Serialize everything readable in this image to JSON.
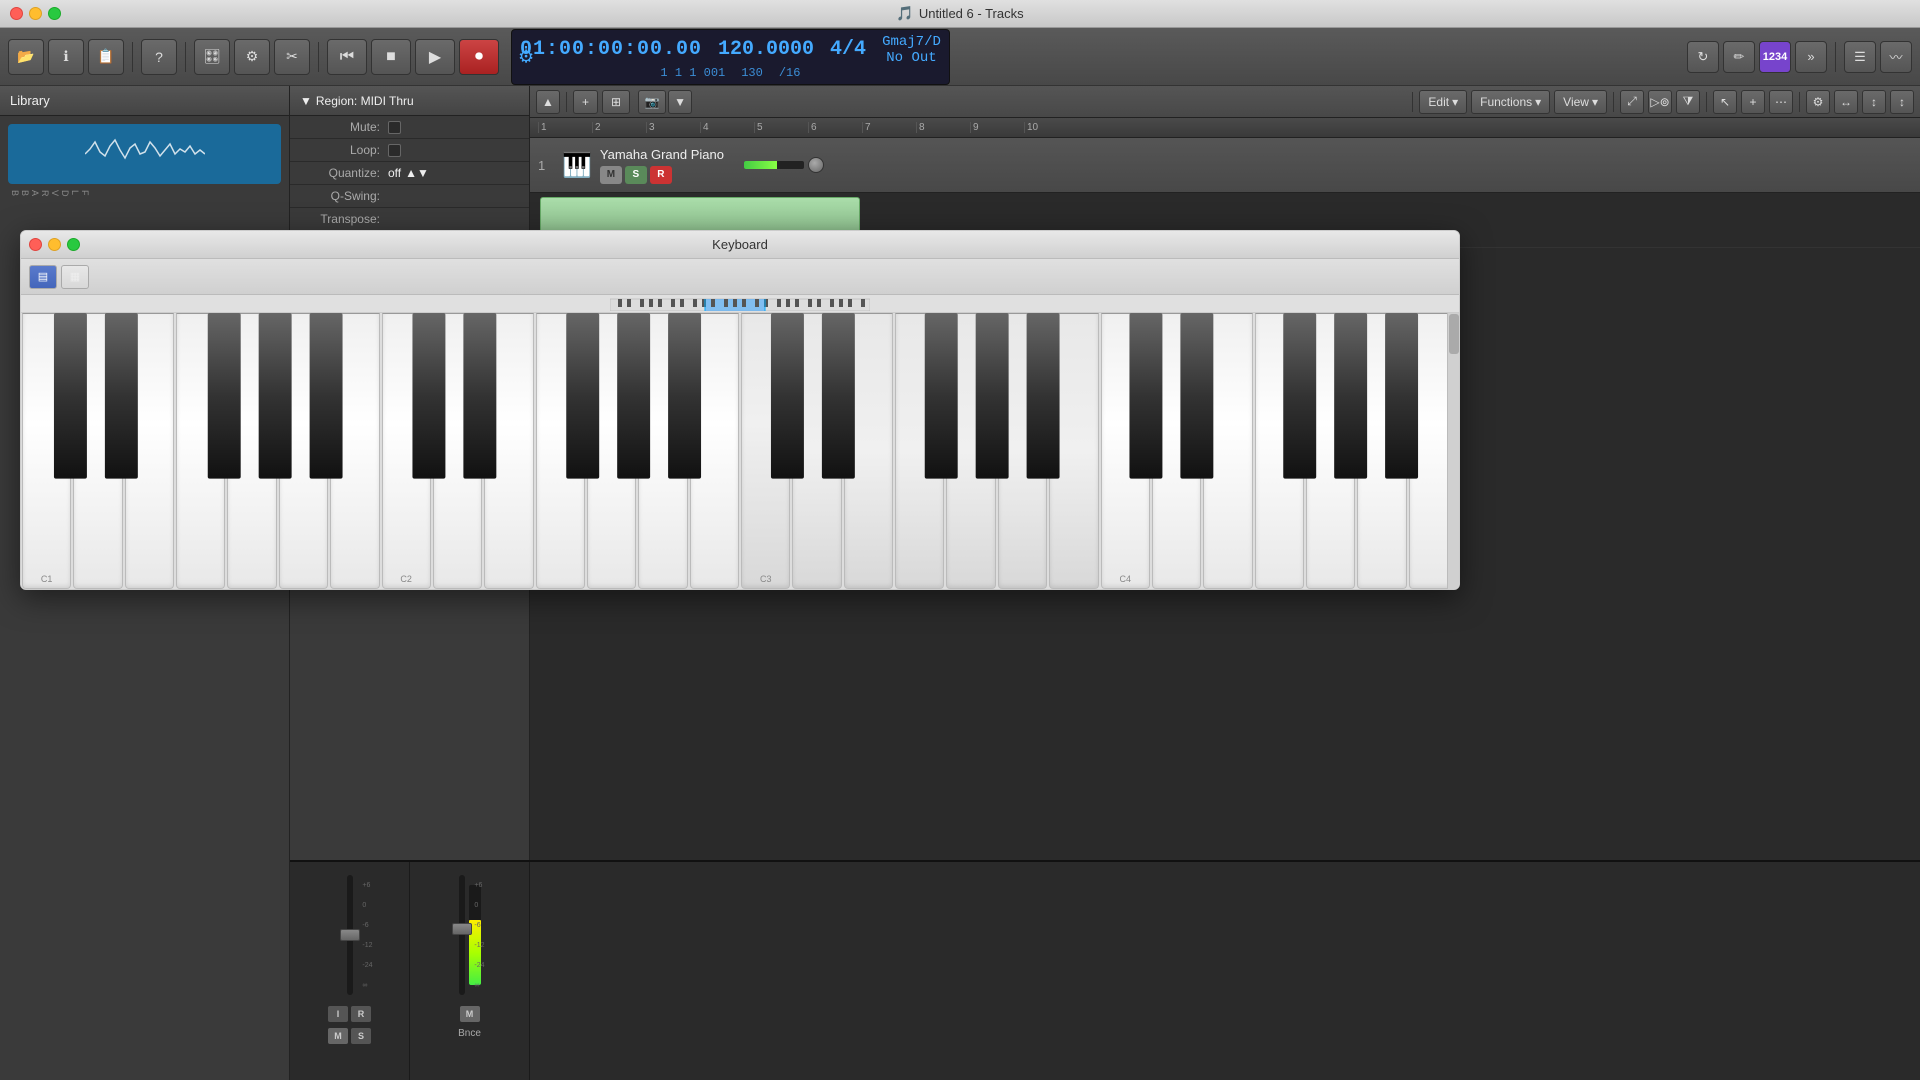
{
  "window": {
    "title": "Untitled 6 - Tracks",
    "icon": "🎵"
  },
  "toolbar": {
    "buttons": [
      "💾",
      "ℹ️",
      "📋",
      "?",
      "🎛️",
      "⚙️",
      "✂️"
    ],
    "transport": {
      "rewind": "⏮",
      "stop": "⏹",
      "play": "▶",
      "record": "⏺"
    }
  },
  "lcd": {
    "time_primary": "01:00:00:00.00",
    "time_secondary": "1  1  1   001",
    "bpm_primary": "120.0000",
    "bpm_secondary": "130",
    "timesig_primary": "4/4",
    "timesig_secondary": "/16",
    "key": "Gmaj7/D",
    "output": "No Out"
  },
  "sidebar": {
    "title": "Library",
    "thumbnail_label": "waveform"
  },
  "inspector": {
    "title": "Region: MIDI Thru",
    "rows": [
      {
        "label": "Mute:",
        "value": "",
        "type": "checkbox"
      },
      {
        "label": "Loop:",
        "value": "",
        "type": "checkbox"
      },
      {
        "label": "Quantize:",
        "value": "off",
        "type": "dropdown"
      },
      {
        "label": "Q-Swing:",
        "value": "",
        "type": "text"
      },
      {
        "label": "Transpose:",
        "value": "",
        "type": "text"
      }
    ]
  },
  "piano_roll": {
    "toolbar": {
      "add_btn": "+",
      "zoom_btn": "⊞",
      "edit_label": "Edit",
      "functions_label": "Functions",
      "view_label": "View"
    },
    "ruler_marks": [
      "1",
      "2",
      "3",
      "4",
      "5",
      "6",
      "7",
      "8",
      "9",
      "10"
    ]
  },
  "track": {
    "number": "1",
    "name": "Yamaha Grand Piano",
    "icon": "🎹",
    "buttons": {
      "m": "M",
      "s": "S",
      "r": "R"
    }
  },
  "keyboard_window": {
    "title": "Keyboard",
    "labels": {
      "c1": "C1",
      "c2": "C2",
      "c3": "C3",
      "c4": "C4"
    }
  },
  "mixer": {
    "channel1": {
      "label": "",
      "buttons": [
        "I",
        "R"
      ],
      "mute": "M",
      "solo": "S"
    },
    "channel2": {
      "label": "Bnce",
      "mute": "M"
    }
  }
}
